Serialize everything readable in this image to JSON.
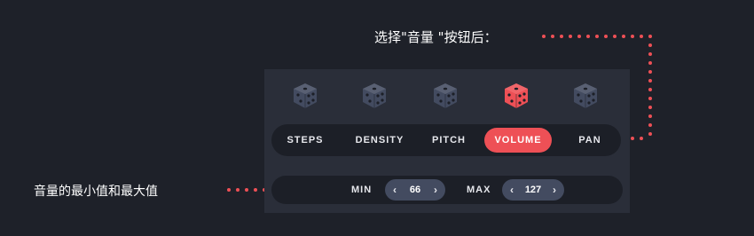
{
  "annotations": {
    "top": "选择\"音量 \"按钮后：",
    "left": "音量的最小值和最大值"
  },
  "colors": {
    "accent": "#ee5056",
    "die_inactive": "#434b60",
    "background": "#1e2129"
  },
  "dice": [
    {
      "icon": "dice-icon",
      "active": false
    },
    {
      "icon": "dice-icon",
      "active": false
    },
    {
      "icon": "dice-icon",
      "active": false
    },
    {
      "icon": "dice-icon",
      "active": true
    },
    {
      "icon": "dice-icon",
      "active": false
    }
  ],
  "tabs": [
    {
      "label": "STEPS",
      "active": false
    },
    {
      "label": "DENSITY",
      "active": false
    },
    {
      "label": "PITCH",
      "active": false
    },
    {
      "label": "VOLUME",
      "active": true
    },
    {
      "label": "PAN",
      "active": false
    }
  ],
  "range": {
    "min_label": "MIN",
    "min_value": "66",
    "max_label": "MAX",
    "max_value": "127",
    "left_arrow": "‹",
    "right_arrow": "›"
  }
}
